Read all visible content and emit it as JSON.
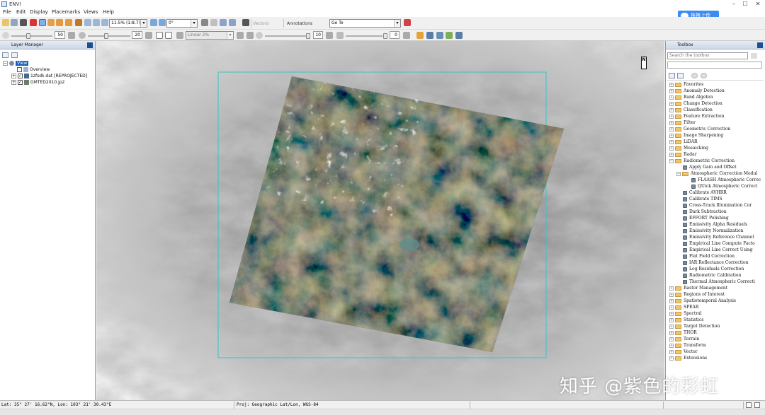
{
  "window": {
    "title": "ENVI",
    "controls": [
      "–",
      "☐",
      "✕"
    ]
  },
  "menu": [
    "File",
    "Edit",
    "Display",
    "Placemarks",
    "Views",
    "Help"
  ],
  "cloud_button": {
    "label": "拖拽上传",
    "color": "#3d8cf0"
  },
  "toolbar1": {
    "zoom": "11.5% (1:8.7)",
    "rotation": "0°",
    "vectors_label": "Vectors",
    "annotations_label": "Annotations",
    "goto_label": "Go To"
  },
  "toolbar2": {
    "brightness": "50",
    "contrast": "20",
    "stretch": "Linear 2%",
    "sharpen": "10",
    "transparency": "0"
  },
  "layer_manager": {
    "title": "Layer Manager",
    "root": "View",
    "items": [
      "Overview",
      "1zfsdk.dat [REPROJECTED]",
      "GMTED2010.jp2"
    ]
  },
  "toolbox": {
    "title": "Toolbox",
    "search_placeholder": "Search the toolbox",
    "folders_top": [
      "Favorites",
      "Anomaly Detection",
      "Band Algebra",
      "Change Detection",
      "Classification",
      "Feature Extraction",
      "Filter",
      "Geometric Correction",
      "Image Sharpening",
      "LiDAR",
      "Mosaicking",
      "Radar"
    ],
    "radiometric": "Radiometric Correction",
    "radiometric_children": [
      "Apply Gain and Offset",
      "Atmospheric Correction Modul"
    ],
    "atmos_children": [
      "FLAASH Atmospheric Correc",
      "QUick Atmospheric Correct"
    ],
    "radiometric_tools": [
      "Calibrate AVHRR",
      "Calibrate TIMS",
      "Cross-Track Illumination Cor",
      "Dark Subtraction",
      "EFFORT Polishing",
      "Emissivity Alpha Residuals",
      "Emissivity Normalization",
      "Emissivity Reference Channel",
      "Empirical Line Compute Facto",
      "Empirical Line Correct Using",
      "Flat Field Correction",
      "IAR Reflectance Correction",
      "Log Residuals Correction",
      "Radiometric Calibration",
      "Thermal Atmospheric Correcti"
    ],
    "folders_bottom": [
      "Raster Management",
      "Regions of Interest",
      "Spatiotemporal Analysis",
      "SPEAR",
      "Spectral",
      "Statistics",
      "Target Detection",
      "THOR",
      "Terrain",
      "Transform",
      "Vector",
      "Extensions"
    ]
  },
  "view": {
    "north_label": "N",
    "bbox_color": "#35c6c6"
  },
  "status": {
    "coords": "Lat: 35° 27' 16.62\"N, Lon: 103° 21' 30.43\"E",
    "projection": "Proj: Geographic Lat/Lon, WGS-84"
  },
  "watermark": "知乎 @紫色的彩虹"
}
